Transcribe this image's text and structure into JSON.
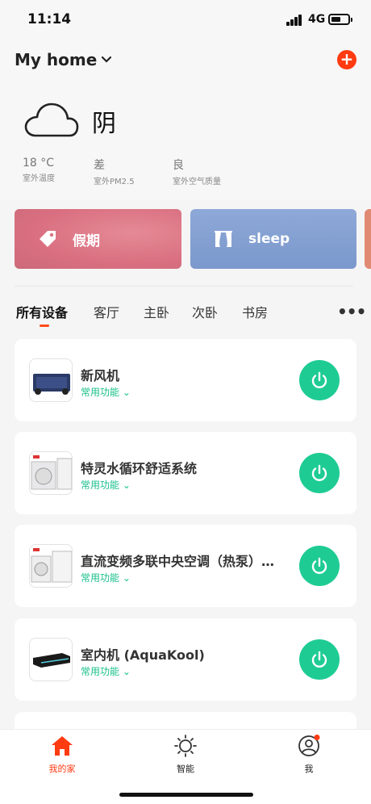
{
  "status_bar": {
    "time": "11:14",
    "network": "4G"
  },
  "header": {
    "home_title": "My home",
    "add_label": "+"
  },
  "weather": {
    "condition": "阴",
    "stats": [
      {
        "value": "18 °C",
        "label": "室外温度"
      },
      {
        "value": "差",
        "label": "室外PM2.5"
      },
      {
        "value": "良",
        "label": "室外空气质量"
      }
    ]
  },
  "scenes": [
    {
      "label": "假期",
      "color": "#d9707f"
    },
    {
      "label": "sleep",
      "color": "#7e9bd0"
    }
  ],
  "tabs": [
    "所有设备",
    "客厅",
    "主卧",
    "次卧",
    "书房"
  ],
  "more_label": "•••",
  "devices": [
    {
      "name": "新风机",
      "sub": "常用功能"
    },
    {
      "name": "特灵水循环舒适系统",
      "sub": "常用功能"
    },
    {
      "name": "直流变频多联中央空调（热泵）…",
      "sub": "常用功能"
    },
    {
      "name": "室内机 (AquaKool)",
      "sub": "常用功能"
    }
  ],
  "nav": [
    {
      "label": "我的家",
      "icon": "home-icon"
    },
    {
      "label": "智能",
      "icon": "sun-icon"
    },
    {
      "label": "我",
      "icon": "user-icon"
    }
  ],
  "colors": {
    "accent": "#ff3b12",
    "power": "#1ecc93",
    "green_text": "#19c08b"
  }
}
